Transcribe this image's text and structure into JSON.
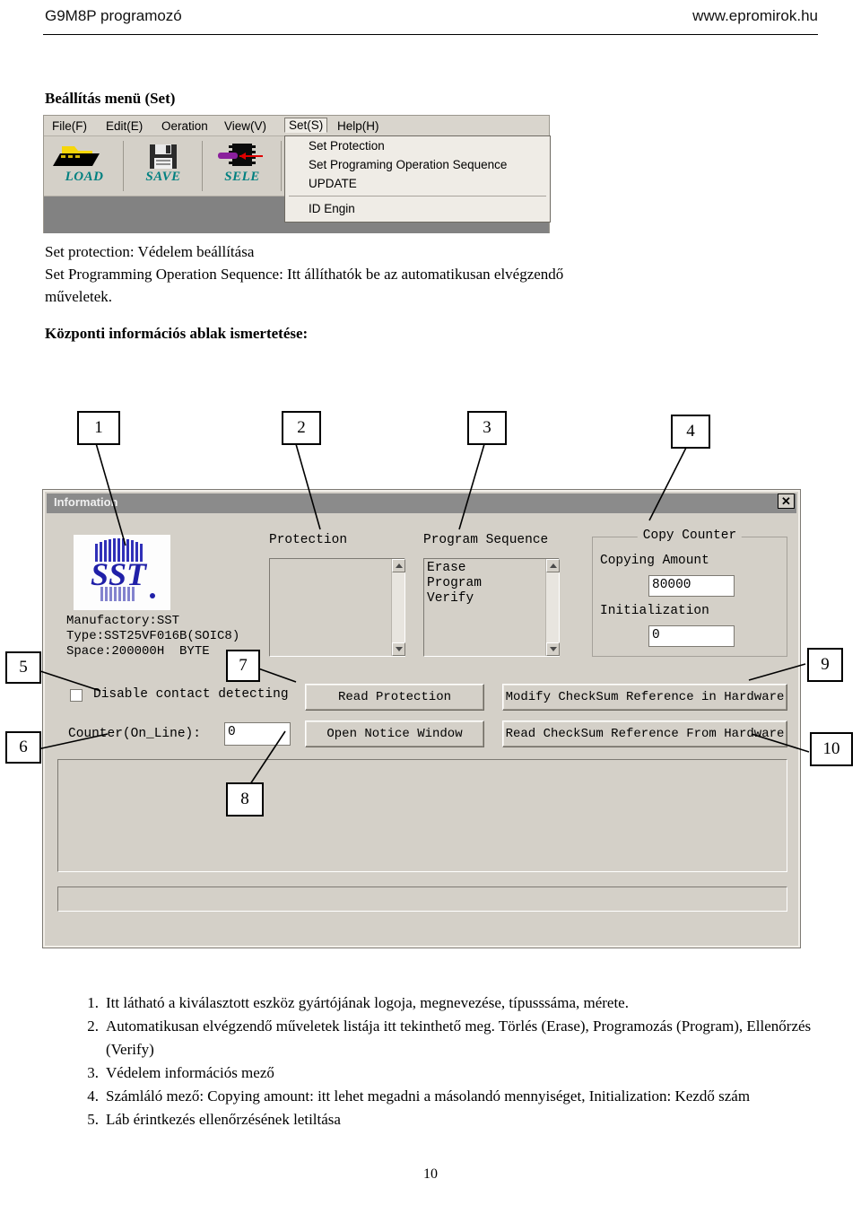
{
  "header": {
    "left": "G9M8P programozó",
    "right": "www.epromirok.hu"
  },
  "section_heading": "Beállítás menü (Set)",
  "app_window": {
    "menubar": [
      {
        "label": "File(F)",
        "selected": false
      },
      {
        "label": "Edit(E)",
        "selected": false
      },
      {
        "label": "Oeration",
        "selected": false
      },
      {
        "label": "View(V)",
        "selected": false
      },
      {
        "label": "Set(S)",
        "selected": true
      },
      {
        "label": "Help(H)",
        "selected": false
      }
    ],
    "toolbar": [
      {
        "label": "LOAD",
        "icon": "open-folder-icon"
      },
      {
        "label": "SAVE",
        "icon": "floppy-disk-icon"
      },
      {
        "label": "SELE",
        "icon": "chip-select-icon"
      }
    ],
    "dropdown": {
      "items": [
        {
          "label": "Set Protection",
          "submenu": false
        },
        {
          "label": "Set Programing Operation Sequence",
          "submenu": false
        },
        {
          "label": "UPDATE",
          "submenu": false
        }
      ],
      "items_after_separator": [
        {
          "label": "ID Engin",
          "submenu": true
        }
      ]
    }
  },
  "description": {
    "line1": "Set protection: Védelem beállítása",
    "line2": "Set Programming Operation Sequence: Itt állíthatók be az automatikusan elvégzendő",
    "line3": "műveletek.",
    "subheading": "Központi információs ablak ismertetése:"
  },
  "callouts": [
    {
      "number": "1"
    },
    {
      "number": "2"
    },
    {
      "number": "3"
    },
    {
      "number": "4"
    },
    {
      "number": "5"
    },
    {
      "number": "6"
    },
    {
      "number": "7"
    },
    {
      "number": "8"
    },
    {
      "number": "9"
    },
    {
      "number": "10"
    }
  ],
  "dialog": {
    "title": "Information",
    "close_label": "✕",
    "device": {
      "manufactory": "Manufactory:SST",
      "type": "Type:SST25VF016B(SOIC8)",
      "space": "Space:200000H  BYTE"
    },
    "protection": {
      "label": "Protection",
      "items": ""
    },
    "program_sequence": {
      "label": "Program Sequence",
      "items": "Erase\nProgram\nVerify"
    },
    "copy_counter": {
      "caption": "Copy Counter",
      "copying_amount_label": "Copying Amount",
      "copying_amount_value": "80000",
      "initialization_label": "Initialization",
      "initialization_value": "0"
    },
    "disable_contact_label": "Disable contact detecting",
    "counter_label": "Counter(On_Line):",
    "counter_value": "0",
    "buttons": {
      "read_protection": "Read Protection",
      "open_notice_window": "Open  Notice Window",
      "modify_checksum": "Modify CheckSum Reference in Hardware",
      "read_checksum": "Read CheckSum Reference From Hardware"
    }
  },
  "numbered_list": [
    {
      "num": "1.",
      "text": "Itt látható a kiválasztott eszköz gyártójának logoja, megnevezése, típusssáma, mérete."
    },
    {
      "num": "2.",
      "text": "Automatikusan elvégzendő műveletek listája itt tekinthető meg. Törlés (Erase), Programozás (Program), Ellenőrzés (Verify)"
    },
    {
      "num": "3.",
      "text": "Védelem információs mező"
    },
    {
      "num": "4.",
      "text": "Számláló mező: Copying amount: itt lehet megadni a másolandó mennyiséget, Initialization: Kezdő szám"
    },
    {
      "num": "5.",
      "text": "Láb érintkezés ellenőrzésének letiltása"
    }
  ],
  "page_number": "10",
  "colors": {
    "toolbar_label": "#008080",
    "dialog_face": "#d4d0c8",
    "titlebar": "#8b8b8b",
    "logo_blue": "#2222aa"
  }
}
